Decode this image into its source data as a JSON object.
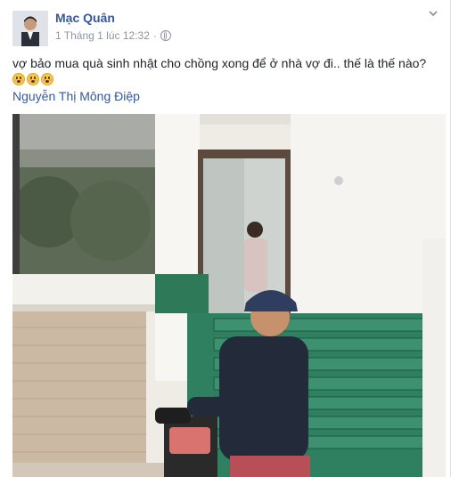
{
  "post": {
    "author": "Mạc Quân",
    "timestamp": "1 Tháng 1 lúc 12:32",
    "separator": "·",
    "privacy_icon": "globe-icon",
    "menu_icon": "chevron-down-icon",
    "text": "vợ bảo mua quà sinh nhật cho chồng xong để ở nhà vợ đi.. thế là thế nào?",
    "emoji_count": 3,
    "emoji_icon": "flushed-face-icon",
    "tagged_user": "Nguyễn Thị Mông Điệp"
  },
  "colors": {
    "link": "#365899",
    "meta": "#90949c",
    "text": "#1d2129"
  }
}
